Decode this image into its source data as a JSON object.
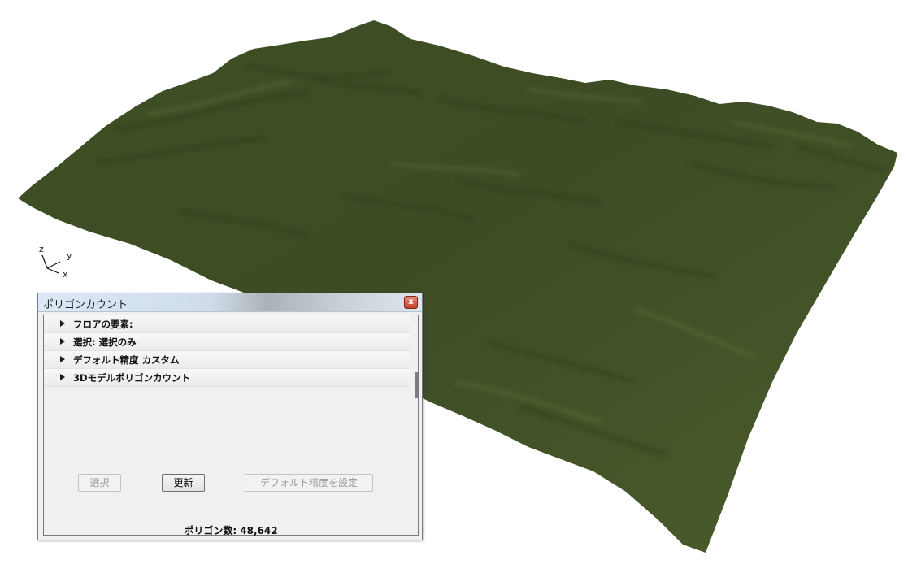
{
  "scene": {
    "terrain_color": "#435327",
    "axes": {
      "z": "z",
      "y": "y",
      "x": "x"
    }
  },
  "dialog": {
    "title": "ポリゴンカウント",
    "close_label": "x",
    "sections": [
      {
        "label": "フロアの要素:"
      },
      {
        "label": "選択: 選択のみ"
      },
      {
        "label": "デフォルト精度 カスタム"
      },
      {
        "label": "3Dモデルポリゴンカウント"
      }
    ],
    "buttons": {
      "select": "選択",
      "update": "更新",
      "set_default": "デフォルト精度を設定"
    },
    "polygon_count": "ポリゴン数: 48,642"
  }
}
